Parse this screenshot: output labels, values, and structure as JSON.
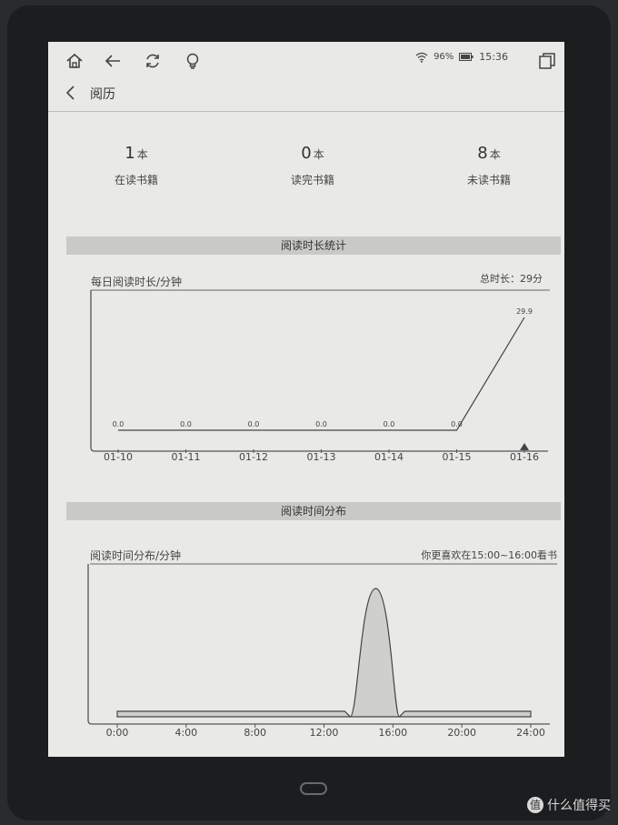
{
  "statusbar": {
    "battery": "96%",
    "time": "15:36",
    "icons": [
      "home-icon",
      "back-arrow-icon",
      "refresh-icon",
      "lightbulb-icon",
      "wifi-icon",
      "battery-icon",
      "window-icon"
    ]
  },
  "header": {
    "title": "阅历"
  },
  "stats": [
    {
      "value": "1",
      "unit": "本",
      "label": "在读书籍"
    },
    {
      "value": "0",
      "unit": "本",
      "label": "读完书籍"
    },
    {
      "value": "8",
      "unit": "本",
      "label": "未读书籍"
    }
  ],
  "sections": {
    "duration": "阅读时长统计",
    "distribution": "阅读时间分布"
  },
  "chart_data": [
    {
      "type": "line",
      "title": "每日阅读时长/分钟",
      "summary": "总时长：29分",
      "categories": [
        "01-10",
        "01-11",
        "01-12",
        "01-13",
        "01-14",
        "01-15",
        "01-16"
      ],
      "values": [
        0.0,
        0.0,
        0.0,
        0.0,
        0.0,
        0.0,
        29.9
      ],
      "value_labels": [
        "0.0",
        "0.0",
        "0.0",
        "0.0",
        "0.0",
        "0.0",
        "29.9"
      ],
      "selected_index": 6,
      "ylim": [
        0,
        32
      ]
    },
    {
      "type": "area",
      "title": "阅读时间分布/分钟",
      "summary": "你更喜欢在15:00~16:00看书",
      "x_ticks": [
        "0:00",
        "4:00",
        "8:00",
        "12:00",
        "16:00",
        "20:00",
        "24:00"
      ],
      "peak_hour": 15,
      "peak_value": 29.9,
      "baseline_value": 0
    }
  ],
  "device": {
    "watermark": "什么值得买",
    "watermark_badge": "值"
  }
}
